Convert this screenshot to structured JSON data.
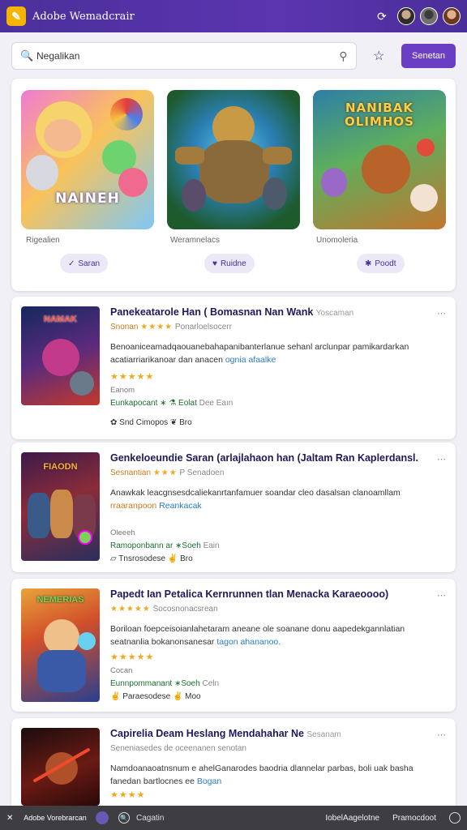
{
  "header": {
    "logo_glyph": "✎",
    "title": "Adobe Wemadcrair",
    "icons": [
      "refresh-icon",
      "avatar",
      "avatar",
      "avatar"
    ],
    "refresh_glyph": "⟳"
  },
  "search": {
    "value": "Negalikan",
    "search_glyph": "🔍",
    "mic_glyph": "⚲",
    "star_glyph": "☆",
    "button_label": "Senetan"
  },
  "featured": {
    "tiles": [
      {
        "label": "Rigealien",
        "button": "Saran",
        "button_glyph": "✓",
        "banner": "NAINEH"
      },
      {
        "label": "Weramnelacs",
        "button": "Ruidne",
        "button_glyph": "♥",
        "banner": ""
      },
      {
        "label": "Unomoleria",
        "button": "Poodt",
        "button_glyph": "✱",
        "banner": "NANIBAK OLIMHOS"
      }
    ]
  },
  "games": [
    {
      "thumb_banner": "NAMAK",
      "title": "Panekeatarole Han ( Bomasnan Nan Wank",
      "title_tail": "Yoscaman",
      "meta_prefix": "Snonan",
      "meta_stars": "★★★★",
      "meta_sub": "Ponarloelsocerr",
      "desc": "Benoaniceamadqaouanebahapanibanterlanue sehanl arclunpar pamikardarkan acatiarriarikanoar dan anacen",
      "desc_link": "ognia afaalke",
      "stars_row": "★★★★★",
      "small": "Eanom",
      "dev": "Eunkapocant ∗ ⚗ Eolat",
      "dev_tail": "Dee    Eaın",
      "tags": "✿  Snd Cimopos ❦ Bro"
    },
    {
      "thumb_banner": "FIAODN",
      "title": "Genkeloeundie Saran (arlajlahaon han (Jaltam Ran Kaplerdansl.",
      "title_tail": "",
      "meta_prefix": "Sesnantian",
      "meta_stars": "★★★",
      "meta_sub": "P Senadoen",
      "desc": "Anawkak leacgnsesdcaliekanrtanfamuer soandar cleo dasalsan clanoamllam",
      "desc_link": "Reankacak",
      "desc_prefix": "rraaranpoon",
      "stars_row": "",
      "small": "Oleeeh",
      "dev": "Ramoponbann ar ∗Soeh",
      "dev_tail": "Eain",
      "tags": "▱  Tnsrosodese ✌ Bro"
    },
    {
      "thumb_banner": "NEMERIAS",
      "title": "Papedt Ian Petalica Kernrunnen tlan Menacka Karaeoooo)",
      "title_tail": "",
      "meta_prefix": "",
      "meta_stars": "★★★★★",
      "meta_sub": "Socosnonacsrean",
      "desc": "Boriloan foepceisoianlahetaram aneane ole soanane donu aapedekgannlatian seatnanlia bokanonsanesar",
      "desc_link": "tagon ahananoo.",
      "stars_row": "★★★★★",
      "small": "Cocan",
      "dev": "Eunnpommanant ∗Soeh",
      "dev_tail": "Celn",
      "tags": "✌  Paraesodese ✌ Moo"
    },
    {
      "thumb_banner": "",
      "title": "Capirelia Deam Heslang Mendahahar Ne",
      "title_tail": "Sesanam",
      "meta_prefix": "",
      "meta_stars": "",
      "meta_sub": "Seneniasedes de oceenanen senotan",
      "desc": "Namdoanaoatnsnum e ahelGanarodes baodria dlannelar parbas, boli uak basha fanedan bartlocnes ee",
      "desc_link": "Bogan",
      "stars_row": "★★★★",
      "small": "",
      "dev": "",
      "dev_tail": "",
      "tags": ""
    }
  ],
  "taskbar": {
    "close_glyph": "✕",
    "app_label": "Adobe Vorebrarcan",
    "search_label": "Cagatin",
    "item1": "IobelAagelotne",
    "item2": "Pramocdoot"
  },
  "card_more_glyph": "⋯"
}
